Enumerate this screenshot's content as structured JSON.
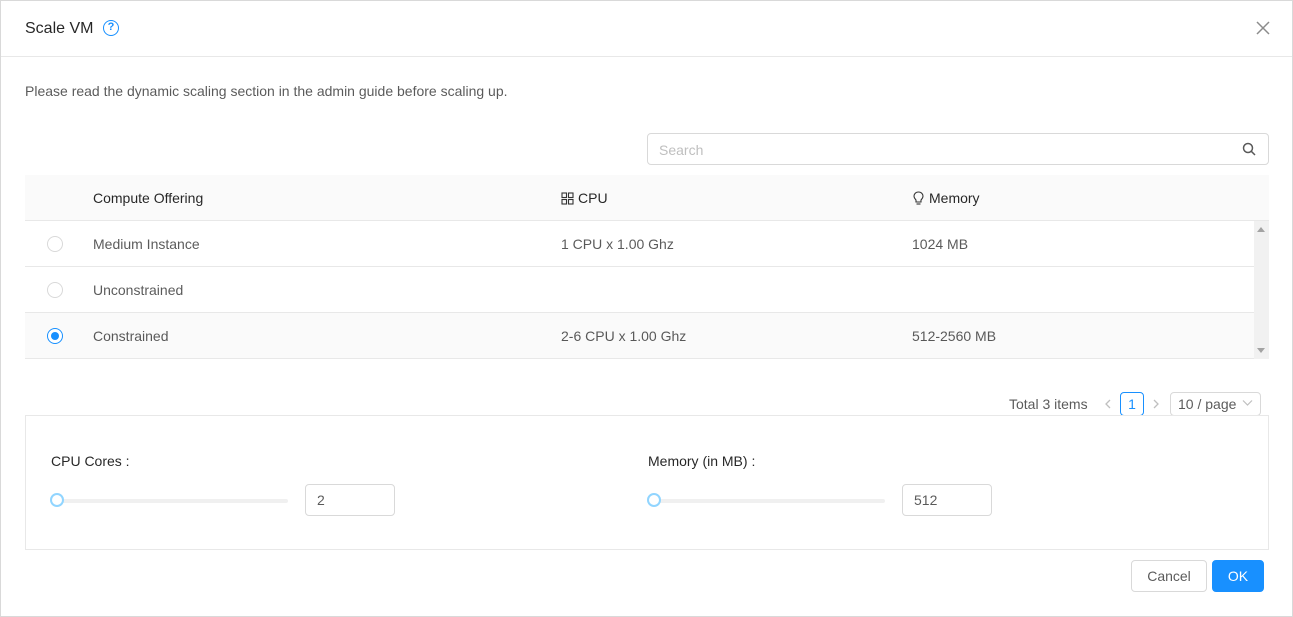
{
  "dialog": {
    "title": "Scale VM",
    "notice": "Please read the dynamic scaling section in the admin guide before scaling up."
  },
  "search": {
    "placeholder": "Search",
    "value": ""
  },
  "table": {
    "headers": {
      "offering": "Compute Offering",
      "cpu": "CPU",
      "memory": "Memory"
    },
    "rows": [
      {
        "name": "Medium Instance",
        "cpu": "1 CPU x 1.00 Ghz",
        "memory": "1024 MB",
        "selected": false
      },
      {
        "name": "Unconstrained",
        "cpu": "",
        "memory": "",
        "selected": false
      },
      {
        "name": "Constrained",
        "cpu": "2-6 CPU x 1.00 Ghz",
        "memory": "512-2560 MB",
        "selected": true
      }
    ]
  },
  "pagination": {
    "total": "Total 3 items",
    "current": "1",
    "page_size": "10 / page"
  },
  "form": {
    "cpu_label": "CPU Cores",
    "cpu_value": "2",
    "memory_label": "Memory (in MB)",
    "memory_value": "512"
  },
  "footer": {
    "cancel": "Cancel",
    "ok": "OK"
  },
  "icons": {
    "help": "question-circle-icon",
    "close": "close-icon",
    "search": "search-icon",
    "cpu": "appstore-icon",
    "memory": "bulb-icon"
  },
  "colors": {
    "primary": "#1890ff",
    "slider_handle": "#91d5ff"
  }
}
